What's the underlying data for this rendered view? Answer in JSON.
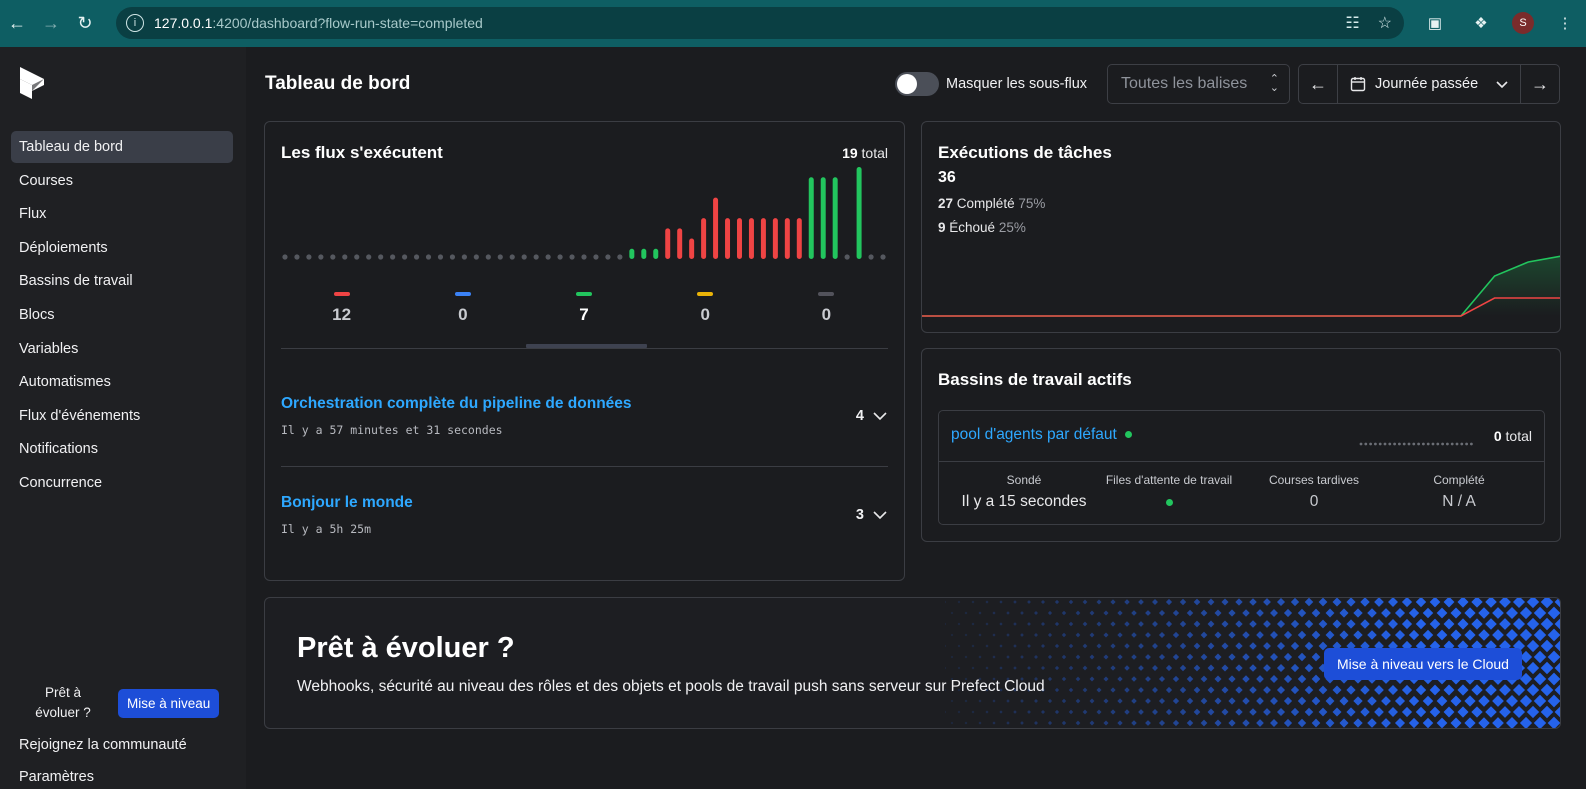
{
  "browser": {
    "url_host": "127.0.0.1",
    "url_rest": ":4200/dashboard?flow-run-state=completed",
    "avatar_letter": "S"
  },
  "sidebar": {
    "items": [
      {
        "label": "Tableau de bord",
        "active": true
      },
      {
        "label": "Courses"
      },
      {
        "label": "Flux"
      },
      {
        "label": "Déploiements"
      },
      {
        "label": "Bassins de travail"
      },
      {
        "label": "Blocs"
      },
      {
        "label": "Variables"
      },
      {
        "label": "Automatismes"
      },
      {
        "label": "Flux d'événements"
      },
      {
        "label": "Notifications"
      },
      {
        "label": "Concurrence"
      }
    ],
    "upgrade_text_line1": "Prêt à",
    "upgrade_text_line2": "évoluer ?",
    "upgrade_button": "Mise à niveau",
    "community_link": "Rejoignez la communauté",
    "settings_link": "Paramètres"
  },
  "header": {
    "title": "Tableau de bord",
    "subflows_label": "Masquer les sous-flux",
    "tags_placeholder": "Toutes les balises",
    "date_range": "Journée passée"
  },
  "flow_runs": {
    "title": "Les flux s'exécutent",
    "total_count": "19",
    "total_label": "total",
    "states": [
      {
        "key": "failed",
        "count": "12",
        "color": "#ef4444"
      },
      {
        "key": "running",
        "count": "0",
        "color": "#3b82f6"
      },
      {
        "key": "completed",
        "count": "7",
        "color": "#22c55e",
        "selected": true
      },
      {
        "key": "scheduled",
        "count": "0",
        "color": "#eab308"
      },
      {
        "key": "cancelled",
        "count": "0",
        "color": "#52525b"
      }
    ],
    "flows": [
      {
        "name": "Orchestration complète du pipeline de données",
        "time": "Il y a 57 minutes et 31 secondes",
        "count": "4"
      },
      {
        "name": "Bonjour le monde",
        "time": "Il y a 5h 25m",
        "count": "3"
      }
    ]
  },
  "chart_data": [
    {
      "type": "bar",
      "description_series": "flow run durations by state",
      "values": [
        0,
        0,
        0,
        0,
        0,
        0,
        0,
        0,
        0,
        0,
        0,
        0,
        0,
        0,
        0,
        0,
        0,
        0,
        0,
        0,
        0,
        0,
        0,
        0,
        0,
        0,
        0,
        0,
        0,
        1,
        1,
        1,
        3,
        3,
        2,
        4,
        6,
        4,
        4,
        4,
        4,
        4,
        4,
        4,
        8,
        8,
        8,
        0,
        9,
        0,
        0
      ],
      "states": [
        "n",
        "n",
        "n",
        "n",
        "n",
        "n",
        "n",
        "n",
        "n",
        "n",
        "n",
        "n",
        "n",
        "n",
        "n",
        "n",
        "n",
        "n",
        "n",
        "n",
        "n",
        "n",
        "n",
        "n",
        "n",
        "n",
        "n",
        "n",
        "n",
        "c",
        "c",
        "c",
        "f",
        "f",
        "f",
        "f",
        "f",
        "f",
        "f",
        "f",
        "f",
        "f",
        "f",
        "f",
        "c",
        "c",
        "c",
        "n",
        "c",
        "n",
        "n"
      ]
    },
    {
      "type": "area",
      "series": [
        {
          "key": "completed",
          "values": [
            0,
            0,
            0,
            0,
            0,
            0,
            0,
            0,
            0,
            0,
            0,
            0,
            0,
            0,
            0,
            0,
            0,
            20,
            27,
            30
          ],
          "color": "#22c55e"
        },
        {
          "key": "failed",
          "values": [
            0,
            0,
            0,
            0,
            0,
            0,
            0,
            0,
            0,
            0,
            0,
            0,
            0,
            0,
            0,
            0,
            0,
            9,
            9,
            9
          ],
          "color": "#ef4444"
        }
      ]
    }
  ],
  "task_runs": {
    "title": "Exécutions de tâches",
    "total": "36",
    "completed_count": "27",
    "completed_label": "Complété",
    "completed_pct": "75%",
    "failed_count": "9",
    "failed_label": "Échoué",
    "failed_pct": "25%"
  },
  "work_pools": {
    "title": "Bassins de travail actifs",
    "pool_name": "pool d'agents par défaut",
    "total_count": "0",
    "total_label": "total",
    "columns": [
      {
        "header": "Sondé",
        "value": "Il y a 15 secondes"
      },
      {
        "header": "Files d'attente de travail",
        "value": ""
      },
      {
        "header": "Courses tardives",
        "value": "0"
      },
      {
        "header": "Complété",
        "value": "N / A"
      }
    ]
  },
  "upsell": {
    "title": "Prêt à évoluer ?",
    "subtitle": "Webhooks, sécurité au niveau des rôles et des objets et pools de travail push sans serveur sur Prefect Cloud",
    "button": "Mise à niveau vers le Cloud"
  }
}
